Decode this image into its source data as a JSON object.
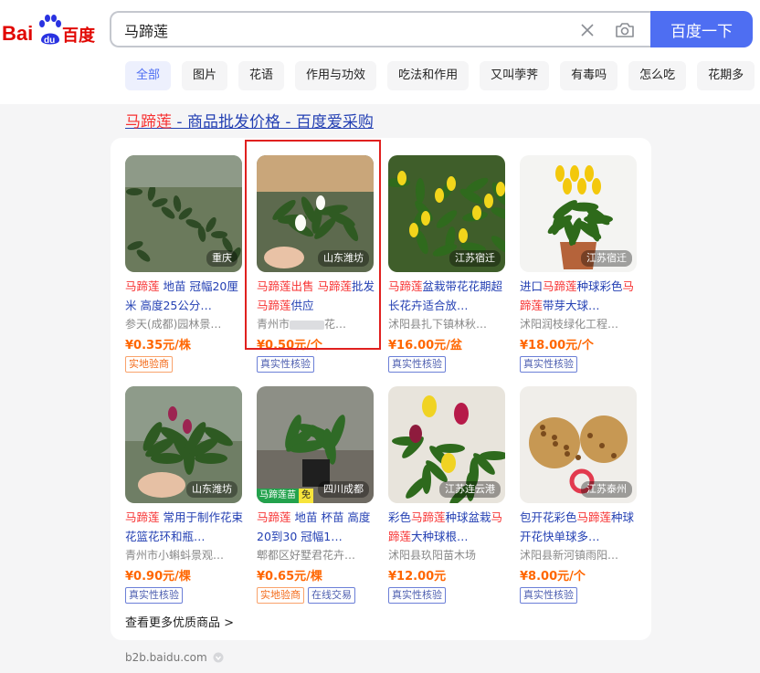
{
  "logo": {
    "left_text": "Bai",
    "mid_text": "du",
    "right_text": "百度"
  },
  "search": {
    "value": "马蹄莲",
    "button_label": "百度一下"
  },
  "tabs": [
    "全部",
    "图片",
    "花语",
    "作用与功效",
    "吃法和作用",
    "又叫荸荠",
    "有毒吗",
    "怎么吃",
    "花期多"
  ],
  "result": {
    "title_hl": "马蹄莲",
    "title_rest": " - 商品批发价格 - 百度爱采购",
    "more_label": "查看更多优质商品 >",
    "domain": "b2b.baidu.com"
  },
  "products": [
    {
      "location": "重庆",
      "title_parts": [
        {
          "t": "马蹄莲",
          "hl": true
        },
        {
          "t": " 地苗 冠幅20厘米 高度25公分…",
          "hl": false
        }
      ],
      "seller": "参天(成都)园林景…",
      "price": "¥0.35元/株",
      "badges": [
        {
          "t": "实地验商",
          "style": "orange"
        }
      ]
    },
    {
      "location": "山东潍坊",
      "title_parts": [
        {
          "t": "马蹄莲",
          "hl": true
        },
        {
          "t": "出售 ",
          "hl": true
        },
        {
          "t": "马蹄莲",
          "hl": true
        },
        {
          "t": "批发 ",
          "hl": false
        },
        {
          "t": "马蹄莲",
          "hl": true
        },
        {
          "t": "供应",
          "hl": false
        }
      ],
      "seller_prefix": "青州市",
      "seller_suffix": "花…",
      "price": "¥0.50元/个",
      "badges": [
        {
          "t": "真实性核验",
          "style": "blue"
        }
      ]
    },
    {
      "location": "江苏宿迁",
      "title_parts": [
        {
          "t": "马蹄莲",
          "hl": true
        },
        {
          "t": "盆栽带花花期超长花卉适合放…",
          "hl": false
        }
      ],
      "seller": "沭阳县扎下镇林秋…",
      "price": "¥16.00元/盆",
      "badges": [
        {
          "t": "真实性核验",
          "style": "blue"
        }
      ]
    },
    {
      "location": "江苏宿迁",
      "title_parts": [
        {
          "t": "进口",
          "hl": false
        },
        {
          "t": "马蹄莲",
          "hl": true
        },
        {
          "t": "种球彩色",
          "hl": false
        },
        {
          "t": "马蹄莲",
          "hl": true
        },
        {
          "t": "带芽大球…",
          "hl": false
        }
      ],
      "seller": "沭阳润枝绿化工程…",
      "price": "¥18.00元/个",
      "badges": [
        {
          "t": "真实性核验",
          "style": "blue"
        }
      ]
    },
    {
      "location": "山东潍坊",
      "title_parts": [
        {
          "t": "马蹄莲",
          "hl": true
        },
        {
          "t": " 常用于制作花束花篮花环和瓶…",
          "hl": false
        }
      ],
      "seller": "青州市小蝌蚪景观…",
      "price": "¥0.90元/棵",
      "badges": [
        {
          "t": "真实性核验",
          "style": "blue"
        }
      ]
    },
    {
      "location": "四川成都",
      "strip_a": "马蹄莲苗",
      "strip_b": "免",
      "title_parts": [
        {
          "t": "马蹄莲",
          "hl": true
        },
        {
          "t": " 地苗 杯苗 高度20到30 冠幅1…",
          "hl": false
        }
      ],
      "seller": "郫都区好墅君花卉…",
      "price": "¥0.65元/棵",
      "badges": [
        {
          "t": "实地验商",
          "style": "orange"
        },
        {
          "t": "在线交易",
          "style": "blue"
        }
      ]
    },
    {
      "location": "江苏连云港",
      "title_parts": [
        {
          "t": "彩色",
          "hl": false
        },
        {
          "t": "马蹄莲",
          "hl": true
        },
        {
          "t": "种球盆栽",
          "hl": false
        },
        {
          "t": "马蹄莲",
          "hl": true
        },
        {
          "t": "大种球根…",
          "hl": false
        }
      ],
      "seller": "沭阳县玖阳苗木场",
      "price": "¥12.00元",
      "badges": [
        {
          "t": "真实性核验",
          "style": "blue"
        }
      ]
    },
    {
      "location": "江苏泰州",
      "title_parts": [
        {
          "t": "包开花彩色",
          "hl": false
        },
        {
          "t": "马蹄莲",
          "hl": true
        },
        {
          "t": "种球开花快单球多…",
          "hl": false
        }
      ],
      "seller": "沭阳县新河镇雨阳…",
      "price": "¥8.00元/个",
      "badges": [
        {
          "t": "真实性核验",
          "style": "blue"
        }
      ]
    }
  ],
  "colors": {
    "brand_blue": "#4e6ef2",
    "link_blue": "#2440b3",
    "highlight_red": "#f73131",
    "price_orange": "#ff6600",
    "box_red": "#e0201f"
  }
}
